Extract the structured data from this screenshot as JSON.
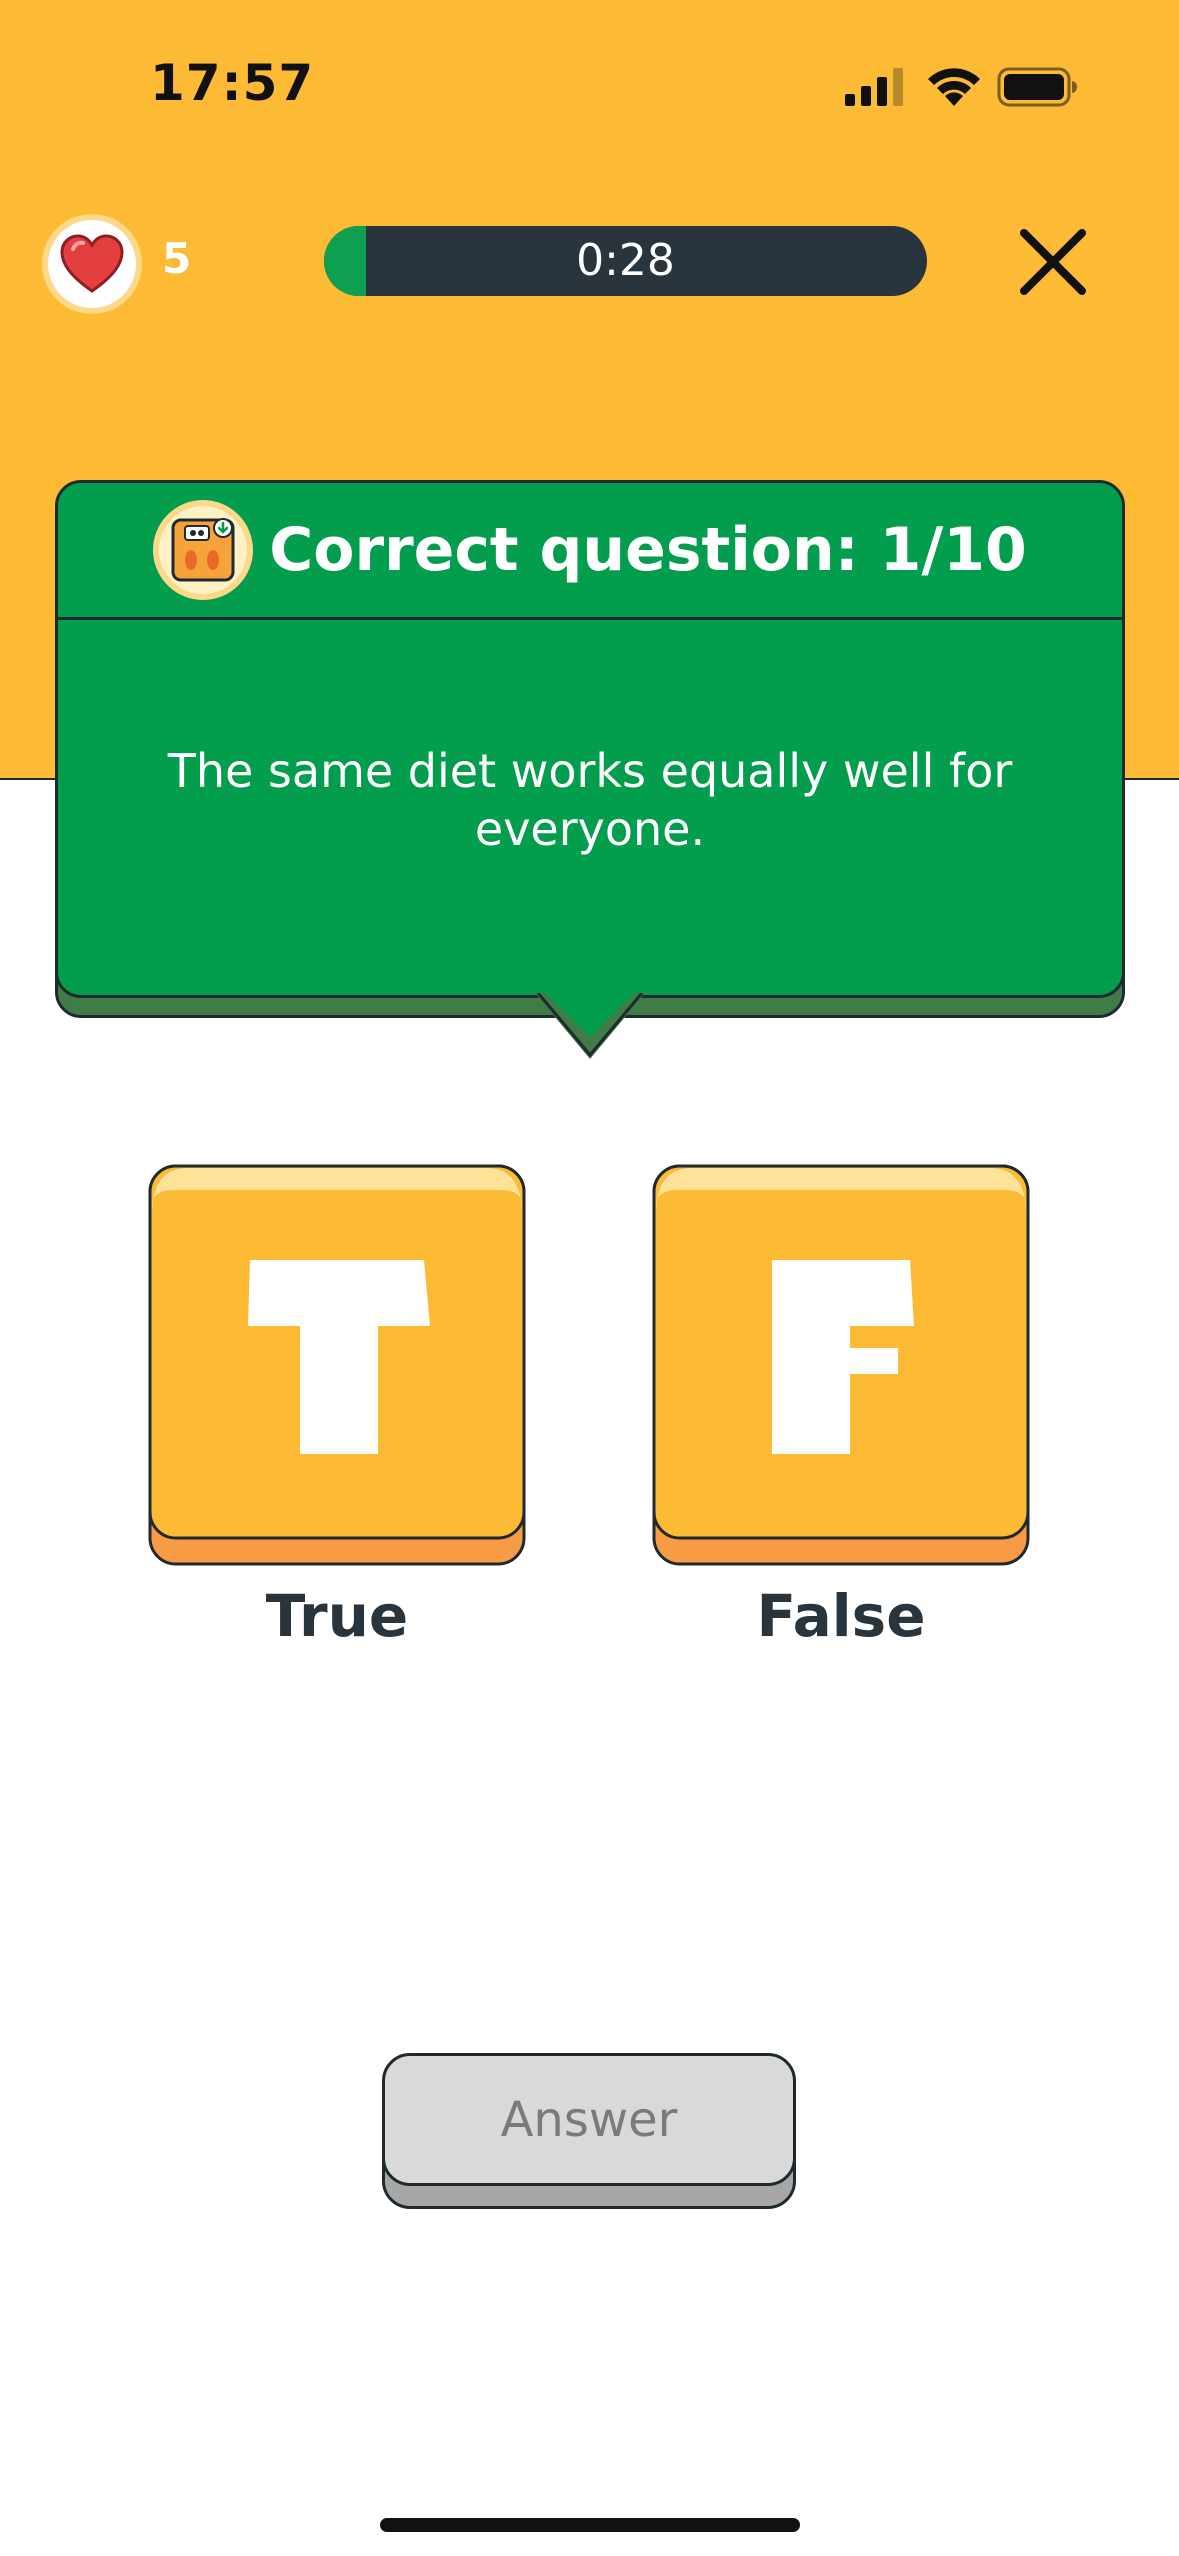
{
  "status_bar": {
    "time": "17:57"
  },
  "header": {
    "lives": "5",
    "timer_text": "0:28",
    "timer_progress": 0.07
  },
  "card": {
    "title": "Correct question: 1/10",
    "question": "The same diet works equally well for everyone."
  },
  "options": {
    "true_letter": "T",
    "true_label": "True",
    "false_letter": "F",
    "false_label": "False"
  },
  "answer_button": {
    "label": "Answer"
  },
  "colors": {
    "background_top": "#FDBA35",
    "card_green": "#029E4E",
    "tile_orange": "#FDBA35",
    "tile_base": "#F79B45",
    "timer_track": "#29343C",
    "timer_fill": "#0E9F50",
    "answer_disabled": "#D9D9D9"
  },
  "icons": [
    "heart-icon",
    "close-icon",
    "bathroom-scale-icon",
    "signal-icon",
    "wifi-icon",
    "battery-icon"
  ]
}
